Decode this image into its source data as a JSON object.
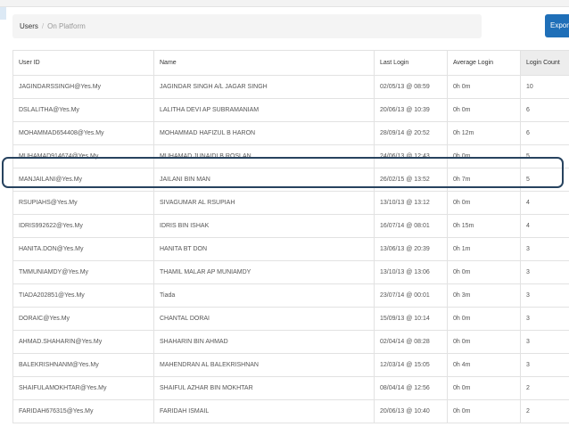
{
  "breadcrumb": {
    "parent": "Users",
    "separator": "/",
    "current": "On Platform"
  },
  "toolbar": {
    "export_label": "Export"
  },
  "table": {
    "columns": [
      "User ID",
      "Name",
      "Last Login",
      "Average Login",
      "Login Count"
    ],
    "sorted_column": "Login Count",
    "highlighted_row": 5,
    "rows": [
      [
        "JAGINDARSSINGH@Yes.My",
        "JAGINDAR SINGH A/L JAGAR SINGH",
        "02/05/13 @ 08:59",
        "0h 0m",
        "10"
      ],
      [
        "DSLALITHA@Yes.My",
        "LALITHA DEVI AP SUBRAMANIAM",
        "20/06/13 @ 10:39",
        "0h 0m",
        "6"
      ],
      [
        "MOHAMMAD654408@Yes.My",
        "MOHAMMAD HAFIZUL B HARON",
        "28/09/14 @ 20:52",
        "0h 12m",
        "6"
      ],
      [
        "MUHAMAD914674@Yes.My",
        "MUHAMAD JUNAIDI B ROSLAN",
        "24/06/13 @ 12:43",
        "0h 0m",
        "5"
      ],
      [
        "MANJAILANI@Yes.My",
        "JAILANI BIN MAN",
        "26/02/15 @ 13:52",
        "0h 7m",
        "5"
      ],
      [
        "RSUPIAHS@Yes.My",
        "SIVAGUMAR AL RSUPIAH",
        "13/10/13 @ 13:12",
        "0h 0m",
        "4"
      ],
      [
        "IDRIS992622@Yes.My",
        "IDRIS BIN ISHAK",
        "16/07/14 @ 08:01",
        "0h 15m",
        "4"
      ],
      [
        "HANITA.DON@Yes.My",
        "HANITA BT DON",
        "13/06/13 @ 20:39",
        "0h 1m",
        "3"
      ],
      [
        "TMMUNIAMDY@Yes.My",
        "THAMIL MALAR AP MUNIAMDY",
        "13/10/13 @ 13:06",
        "0h 0m",
        "3"
      ],
      [
        "TIADA202851@Yes.My",
        "Tiada",
        "23/07/14 @ 00:01",
        "0h 3m",
        "3"
      ],
      [
        "DORAIC@Yes.My",
        "CHANTAL DORAI",
        "15/09/13 @ 10:14",
        "0h 0m",
        "3"
      ],
      [
        "AHMAD.SHAHARIN@Yes.My",
        "SHAHARIN BIN AHMAD",
        "02/04/14 @ 08:28",
        "0h 0m",
        "3"
      ],
      [
        "BALEKRISHNANM@Yes.My",
        "MAHENDRAN AL BALEKRISHNAN",
        "12/03/14 @ 15:05",
        "0h 4m",
        "3"
      ],
      [
        "SHAIFULAMOKHTAR@Yes.My",
        "SHAIFUL AZHAR BIN MOKHTAR",
        "08/04/14 @ 12:56",
        "0h 0m",
        "2"
      ],
      [
        "FARIDAH676315@Yes.My",
        "FARIDAH ISMAIL",
        "20/06/13 @ 10:40",
        "0h 0m",
        "2"
      ]
    ]
  }
}
